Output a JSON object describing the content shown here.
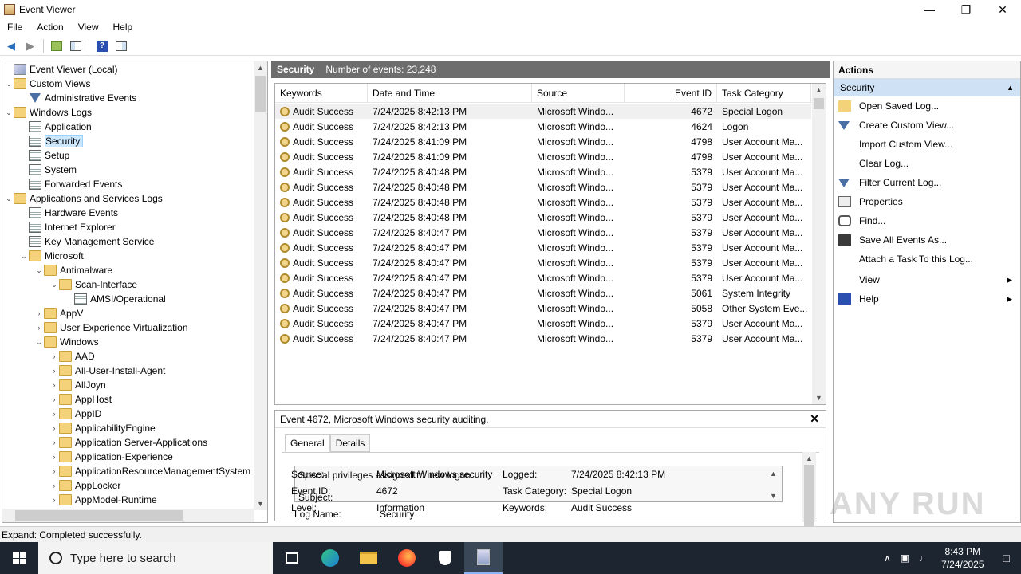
{
  "window": {
    "title": "Event Viewer"
  },
  "menu": [
    "File",
    "Action",
    "View",
    "Help"
  ],
  "tree": [
    {
      "label": "Event Viewer (Local)",
      "level": 0,
      "icon": "event-viewer-icon",
      "exp": ""
    },
    {
      "label": "Custom Views",
      "level": 0,
      "icon": "folder-icon",
      "exp": "v"
    },
    {
      "label": "Administrative Events",
      "level": 1,
      "icon": "filter-icon",
      "exp": ""
    },
    {
      "label": "Windows Logs",
      "level": 0,
      "icon": "folder-icon",
      "exp": "v"
    },
    {
      "label": "Application",
      "level": 1,
      "icon": "log-icon",
      "exp": ""
    },
    {
      "label": "Security",
      "level": 1,
      "icon": "log-icon",
      "exp": "",
      "selected": true
    },
    {
      "label": "Setup",
      "level": 1,
      "icon": "log-icon",
      "exp": ""
    },
    {
      "label": "System",
      "level": 1,
      "icon": "log-icon",
      "exp": ""
    },
    {
      "label": "Forwarded Events",
      "level": 1,
      "icon": "log-icon",
      "exp": ""
    },
    {
      "label": "Applications and Services Logs",
      "level": 0,
      "icon": "folder-icon",
      "exp": "v"
    },
    {
      "label": "Hardware Events",
      "level": 1,
      "icon": "log-icon",
      "exp": ""
    },
    {
      "label": "Internet Explorer",
      "level": 1,
      "icon": "log-icon",
      "exp": ""
    },
    {
      "label": "Key Management Service",
      "level": 1,
      "icon": "log-icon",
      "exp": ""
    },
    {
      "label": "Microsoft",
      "level": 1,
      "icon": "folder-icon",
      "exp": "v"
    },
    {
      "label": "Antimalware",
      "level": 2,
      "icon": "folder-icon",
      "exp": "v"
    },
    {
      "label": "Scan-Interface",
      "level": 3,
      "icon": "folder-icon",
      "exp": "v"
    },
    {
      "label": "AMSI/Operational",
      "level": 4,
      "icon": "log-icon",
      "exp": ""
    },
    {
      "label": "AppV",
      "level": 2,
      "icon": "folder-icon",
      "exp": ">"
    },
    {
      "label": "User Experience Virtualization",
      "level": 2,
      "icon": "folder-icon",
      "exp": ">"
    },
    {
      "label": "Windows",
      "level": 2,
      "icon": "folder-icon",
      "exp": "v"
    },
    {
      "label": "AAD",
      "level": 3,
      "icon": "folder-icon",
      "exp": ">"
    },
    {
      "label": "All-User-Install-Agent",
      "level": 3,
      "icon": "folder-icon",
      "exp": ">"
    },
    {
      "label": "AllJoyn",
      "level": 3,
      "icon": "folder-icon",
      "exp": ">"
    },
    {
      "label": "AppHost",
      "level": 3,
      "icon": "folder-icon",
      "exp": ">"
    },
    {
      "label": "AppID",
      "level": 3,
      "icon": "folder-icon",
      "exp": ">"
    },
    {
      "label": "ApplicabilityEngine",
      "level": 3,
      "icon": "folder-icon",
      "exp": ">"
    },
    {
      "label": "Application Server-Applications",
      "level": 3,
      "icon": "folder-icon",
      "exp": ">"
    },
    {
      "label": "Application-Experience",
      "level": 3,
      "icon": "folder-icon",
      "exp": ">"
    },
    {
      "label": "ApplicationResourceManagementSystem",
      "level": 3,
      "icon": "folder-icon",
      "exp": ">"
    },
    {
      "label": "AppLocker",
      "level": 3,
      "icon": "folder-icon",
      "exp": ">"
    },
    {
      "label": "AppModel-Runtime",
      "level": 3,
      "icon": "folder-icon",
      "exp": ">"
    }
  ],
  "log": {
    "name": "Security",
    "count_text": "Number of events: 23,248"
  },
  "columns": [
    "Keywords",
    "Date and Time",
    "Source",
    "Event ID",
    "Task Category"
  ],
  "events": [
    [
      "Audit Success",
      "7/24/2025 8:42:13 PM",
      "Microsoft Windo...",
      "4672",
      "Special Logon"
    ],
    [
      "Audit Success",
      "7/24/2025 8:42:13 PM",
      "Microsoft Windo...",
      "4624",
      "Logon"
    ],
    [
      "Audit Success",
      "7/24/2025 8:41:09 PM",
      "Microsoft Windo...",
      "4798",
      "User Account Ma..."
    ],
    [
      "Audit Success",
      "7/24/2025 8:41:09 PM",
      "Microsoft Windo...",
      "4798",
      "User Account Ma..."
    ],
    [
      "Audit Success",
      "7/24/2025 8:40:48 PM",
      "Microsoft Windo...",
      "5379",
      "User Account Ma..."
    ],
    [
      "Audit Success",
      "7/24/2025 8:40:48 PM",
      "Microsoft Windo...",
      "5379",
      "User Account Ma..."
    ],
    [
      "Audit Success",
      "7/24/2025 8:40:48 PM",
      "Microsoft Windo...",
      "5379",
      "User Account Ma..."
    ],
    [
      "Audit Success",
      "7/24/2025 8:40:48 PM",
      "Microsoft Windo...",
      "5379",
      "User Account Ma..."
    ],
    [
      "Audit Success",
      "7/24/2025 8:40:47 PM",
      "Microsoft Windo...",
      "5379",
      "User Account Ma..."
    ],
    [
      "Audit Success",
      "7/24/2025 8:40:47 PM",
      "Microsoft Windo...",
      "5379",
      "User Account Ma..."
    ],
    [
      "Audit Success",
      "7/24/2025 8:40:47 PM",
      "Microsoft Windo...",
      "5379",
      "User Account Ma..."
    ],
    [
      "Audit Success",
      "7/24/2025 8:40:47 PM",
      "Microsoft Windo...",
      "5379",
      "User Account Ma..."
    ],
    [
      "Audit Success",
      "7/24/2025 8:40:47 PM",
      "Microsoft Windo...",
      "5061",
      "System Integrity"
    ],
    [
      "Audit Success",
      "7/24/2025 8:40:47 PM",
      "Microsoft Windo...",
      "5058",
      "Other System Eve..."
    ],
    [
      "Audit Success",
      "7/24/2025 8:40:47 PM",
      "Microsoft Windo...",
      "5379",
      "User Account Ma..."
    ],
    [
      "Audit Success",
      "7/24/2025 8:40:47 PM",
      "Microsoft Windo...",
      "5379",
      "User Account Ma..."
    ]
  ],
  "detail": {
    "title": "Event 4672, Microsoft Windows security auditing.",
    "tabs": [
      "General",
      "Details"
    ],
    "description_line1": "Special privileges assigned to new logon.",
    "description_line2": "Subject:",
    "log_name_label": "Log Name:",
    "log_name": "Security",
    "source_label": "Source:",
    "source": "Microsoft Windows security",
    "logged_label": "Logged:",
    "logged": "7/24/2025 8:42:13 PM",
    "event_id_label": "Event ID:",
    "event_id": "4672",
    "task_category_label": "Task Category:",
    "task_category": "Special Logon",
    "level_label": "Level:",
    "level": "Information",
    "keywords_label": "Keywords:",
    "keywords": "Audit Success"
  },
  "actions": {
    "title": "Actions",
    "section": "Security",
    "items": [
      {
        "label": "Open Saved Log...",
        "icon": "open-folder-icon"
      },
      {
        "label": "Create Custom View...",
        "icon": "filter-icon"
      },
      {
        "label": "Import Custom View...",
        "icon": ""
      },
      {
        "label": "Clear Log...",
        "icon": ""
      },
      {
        "label": "Filter Current Log...",
        "icon": "filter-icon"
      },
      {
        "label": "Properties",
        "icon": "properties-icon"
      },
      {
        "label": "Find...",
        "icon": "find-icon"
      },
      {
        "label": "Save All Events As...",
        "icon": "save-icon"
      },
      {
        "label": "Attach a Task To this Log...",
        "icon": ""
      },
      {
        "label": "View",
        "icon": "",
        "submenu": true
      },
      {
        "label": "Help",
        "icon": "help-icon",
        "submenu": true
      }
    ]
  },
  "status": "Expand:  Completed successfully.",
  "watermark": "ANY RUN",
  "taskbar": {
    "search_placeholder": "Type here to search",
    "time": "8:43 PM",
    "date": "7/24/2025"
  }
}
